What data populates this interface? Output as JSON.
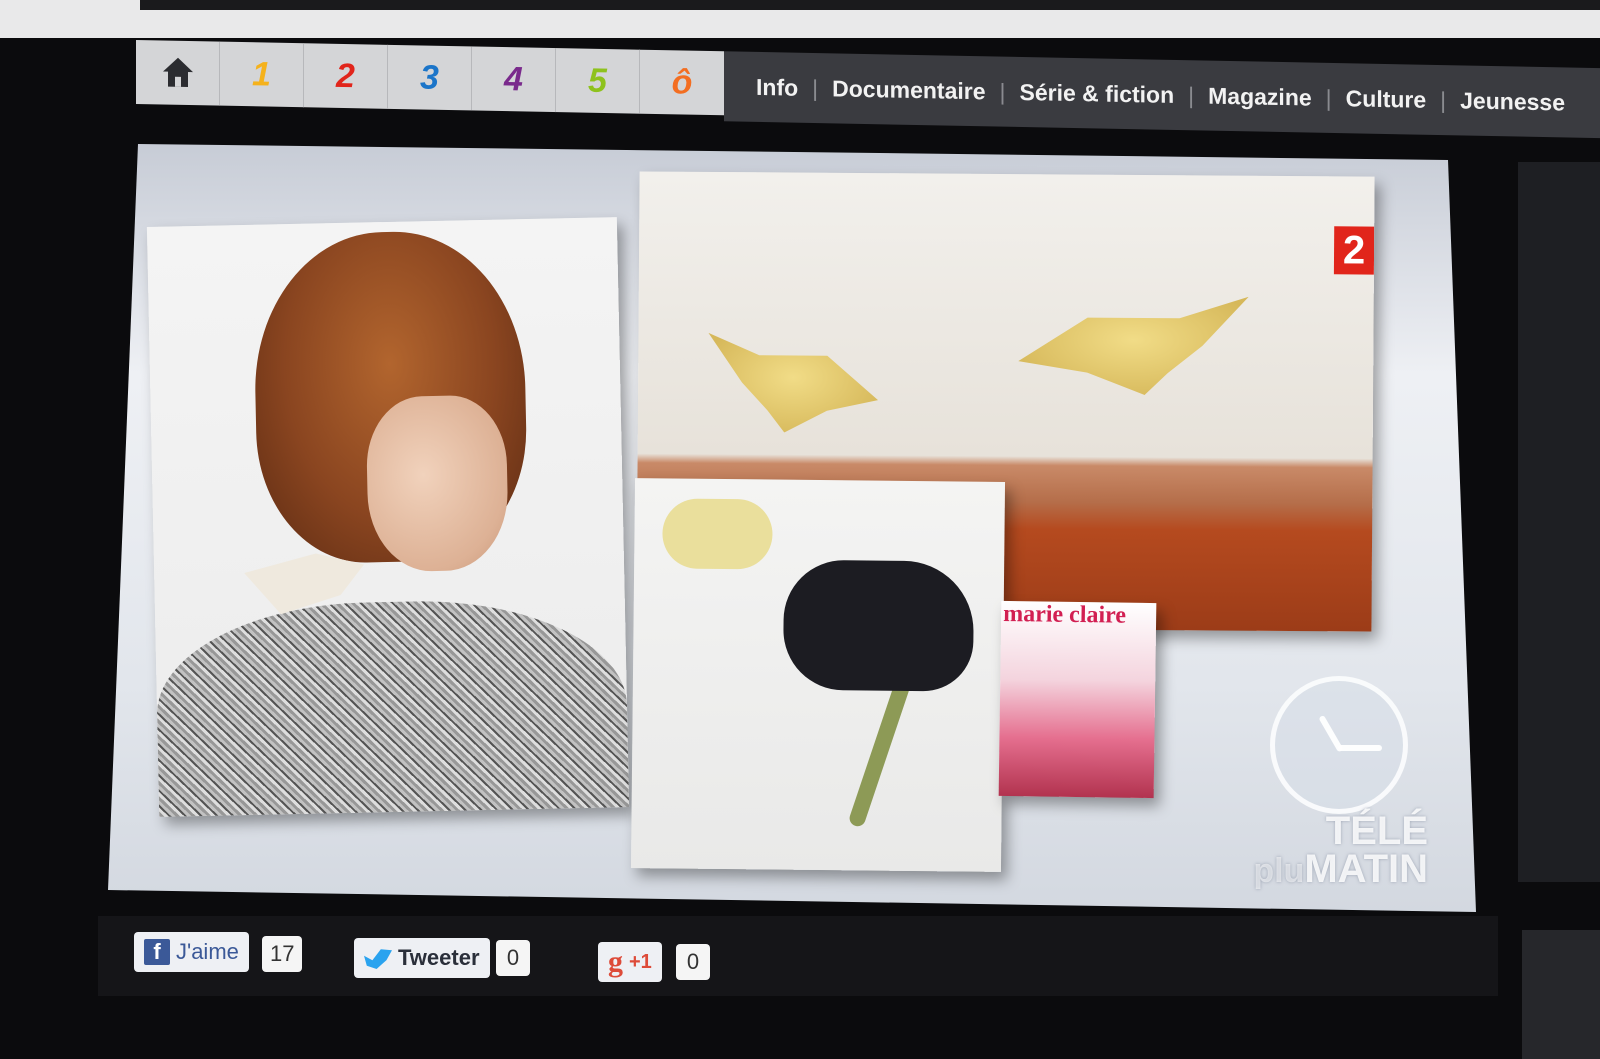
{
  "nav": {
    "channels": [
      {
        "label": "",
        "icon": "home-icon",
        "color": "#2b2c30"
      },
      {
        "label": "1",
        "color": "#f5b21c"
      },
      {
        "label": "2",
        "color": "#e1251b"
      },
      {
        "label": "3",
        "color": "#1b75c9"
      },
      {
        "label": "4",
        "color": "#7a2a8c"
      },
      {
        "label": "5",
        "color": "#8ec21d"
      },
      {
        "label": "ô",
        "color": "#f36e21"
      }
    ],
    "menu": [
      "Info",
      "Documentaire",
      "Série & fiction",
      "Magazine",
      "Culture",
      "Jeunesse"
    ]
  },
  "video": {
    "channel_logo": "2",
    "magazine_title": "marie claire",
    "brand_line1": "TÉLÉ",
    "brand_line2_prefix": "plu",
    "brand_line2": "MATIN"
  },
  "share": {
    "facebook": {
      "label": "J'aime",
      "count": "17"
    },
    "twitter": {
      "label": "Tweeter",
      "count": "0"
    },
    "google": {
      "label": "+1",
      "count": "0"
    }
  }
}
